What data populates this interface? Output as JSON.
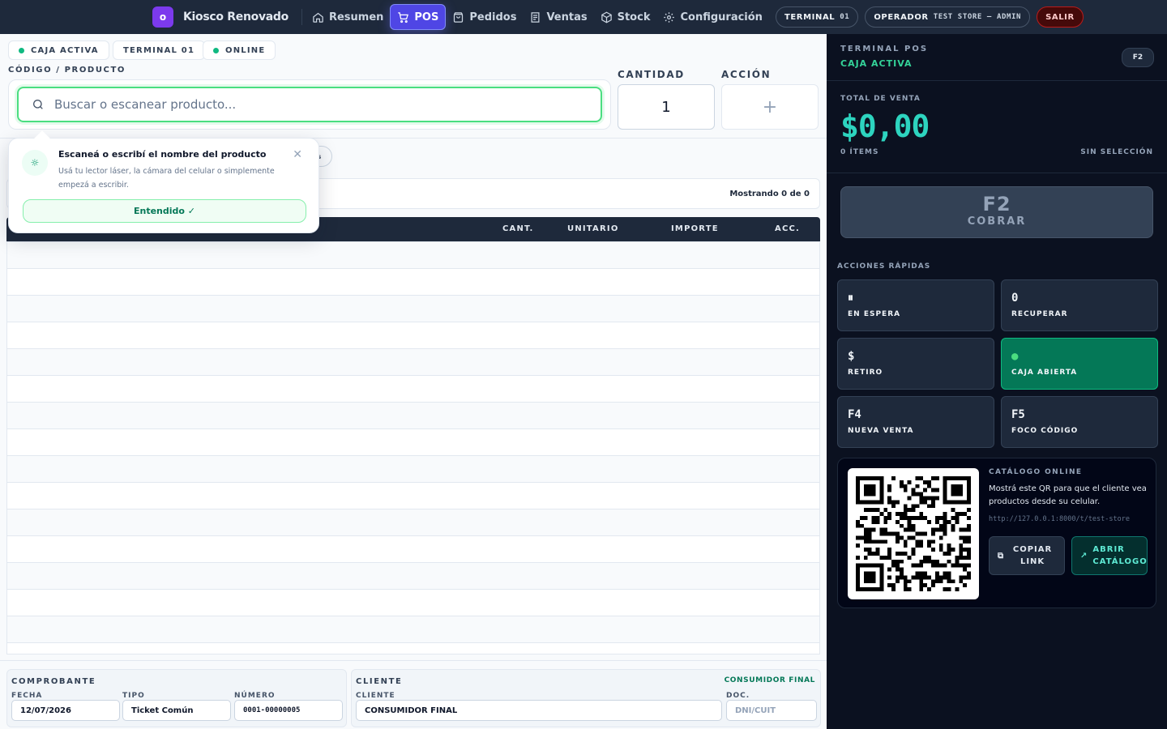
{
  "nav": {
    "brand": "Kiosco Renovado",
    "brand_initial": "o",
    "items": [
      {
        "label": "Resumen",
        "icon": "home-icon"
      },
      {
        "label": "POS",
        "icon": "cart-icon",
        "active": true
      },
      {
        "label": "Pedidos",
        "icon": "bag-icon"
      },
      {
        "label": "Ventas",
        "icon": "receipt-icon"
      },
      {
        "label": "Stock",
        "icon": "box-icon"
      },
      {
        "label": "Configuración",
        "icon": "gear-icon"
      }
    ],
    "terminal_label": "TERMINAL",
    "terminal_num": "01",
    "operator_label": "OPERADOR",
    "operator_value": "TEST STORE — ADMIN",
    "logout": "SALIR"
  },
  "status": {
    "caja": "CAJA ACTIVA",
    "terminal": "TERMINAL 01",
    "online": "ONLINE"
  },
  "entry": {
    "code_label": "CÓDIGO / PRODUCTO",
    "search_placeholder": "Buscar o escanear producto...",
    "qty_label": "CANTIDAD",
    "qty_value": "1",
    "action_label": "ACCIÓN",
    "action_symbol": "+"
  },
  "tooltip": {
    "title": "Escaneá o escribí el nombre del producto",
    "text": "Usá tu lector láser, la cámara del celular o simplemente empezá a escribir.",
    "button": "Entendido ✓",
    "ghost": "os"
  },
  "table": {
    "count": "Mostrando 0 de 0",
    "headers": [
      "CANT.",
      "UNITARIO",
      "IMPORTE",
      "ACC."
    ]
  },
  "footer": {
    "comprobante_title": "COMPROBANTE",
    "fecha_label": "FECHA",
    "fecha_value": "12/07/2026",
    "tipo_label": "TIPO",
    "tipo_value": "Ticket Común",
    "numero_label": "NÚMERO",
    "numero_value": "0001-00000005",
    "cliente_title": "CLIENTE",
    "cliente_tag": "CONSUMIDOR FINAL",
    "cliente_label": "CLIENTE",
    "cliente_value": "CONSUMIDOR FINAL",
    "doc_label": "DOC.",
    "doc_placeholder": "DNI/CUIT"
  },
  "side": {
    "terminal_title": "TERMINAL POS",
    "caja": "CAJA ACTIVA",
    "key": "F2",
    "total_label": "TOTAL DE VENTA",
    "total": "$0,00",
    "items": "0 ÍTEMS",
    "selection": "SIN SELECCIÓN",
    "cobrar_key": "F2",
    "cobrar_label": "COBRAR",
    "quick_title": "ACCIONES RÁPIDAS",
    "quick": [
      {
        "icon": "⏸",
        "label": "EN ESPERA"
      },
      {
        "icon": "0",
        "label": "RECUPERAR"
      },
      {
        "icon": "$",
        "label": "RETIRO"
      },
      {
        "icon": "●",
        "label": "CAJA ABIERTA"
      },
      {
        "icon": "F4",
        "label": "NUEVA VENTA"
      },
      {
        "icon": "F5",
        "label": "FOCO CÓDIGO"
      }
    ],
    "catalog_title": "CATÁLOGO ONLINE",
    "catalog_text": "Mostrá este QR para que el cliente vea productos desde su celular.",
    "catalog_url": "http://127.0.0.1:8000/t/test-store",
    "copy_btn": "COPIAR LINK",
    "open_btn": "ABRIR CATÁLOGO"
  },
  "colors": {
    "accent": "#4f46e5",
    "success": "#10b981",
    "total": "#2dd4bf"
  }
}
